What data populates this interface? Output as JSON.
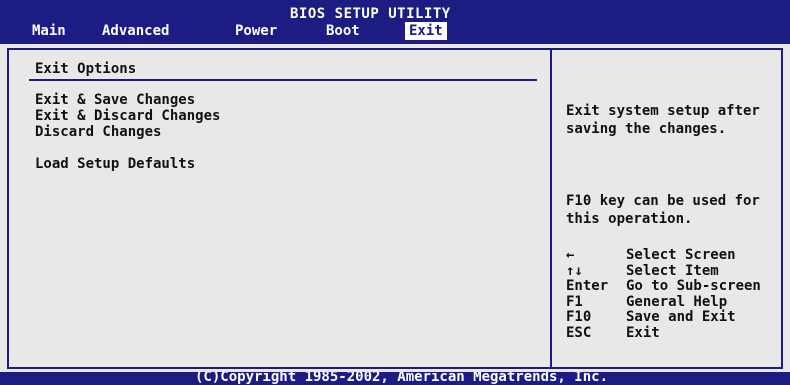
{
  "header": {
    "title": "BIOS SETUP UTILITY",
    "menu": [
      {
        "label": "Main"
      },
      {
        "label": "Advanced"
      },
      {
        "label": "Power"
      },
      {
        "label": "Boot"
      },
      {
        "label": "Exit",
        "active": true
      }
    ]
  },
  "left": {
    "section_title": "Exit Options",
    "options": [
      "Exit & Save Changes",
      "Exit & Discard Changes",
      "Discard Changes",
      "Load Setup Defaults"
    ]
  },
  "right": {
    "help": [
      "Exit system setup after saving the changes.",
      "F10 key can be used for this operation."
    ],
    "keys": [
      {
        "key": "←",
        "icon": "arrow-left-icon",
        "desc": "Select Screen"
      },
      {
        "key": "↑↓",
        "icon": "arrow-up-down-icon",
        "desc": "Select Item"
      },
      {
        "key": "Enter",
        "desc": "Go to Sub-screen"
      },
      {
        "key": "F1",
        "desc": "General Help"
      },
      {
        "key": "F10",
        "desc": "Save and Exit"
      },
      {
        "key": "ESC",
        "desc": "Exit"
      }
    ]
  },
  "footer": {
    "copyright": "(C)Copyright 1985-2002, American Megatrends, Inc."
  },
  "colors": {
    "bar_blue": "#1c1c82",
    "panel_bg": "#e8e8e8",
    "text": "#111111",
    "active_tab_bg": "#ffffff"
  }
}
